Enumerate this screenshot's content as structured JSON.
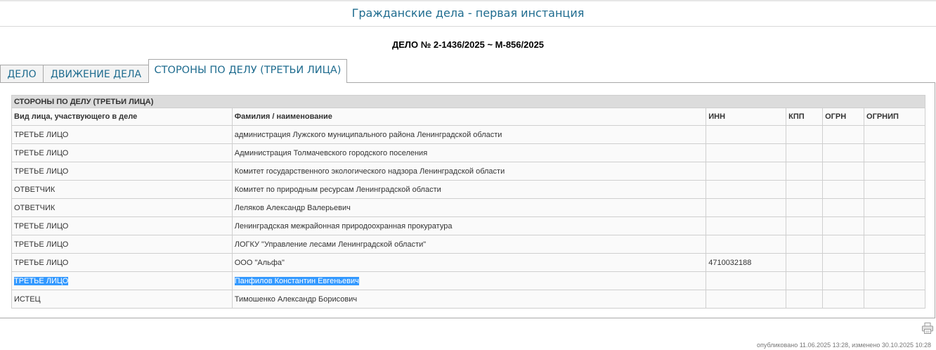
{
  "page_title": "Гражданские дела - первая инстанция",
  "case_title": "ДЕЛО № 2-1436/2025 ~ М-856/2025",
  "tabs": [
    {
      "label": "ДЕЛО"
    },
    {
      "label": "ДВИЖЕНИЕ ДЕЛА"
    },
    {
      "label": "СТОРОНЫ ПО ДЕЛУ (ТРЕТЬИ ЛИЦА)"
    }
  ],
  "active_tab": "СТОРОНЫ ПО ДЕЛУ (ТРЕТЬИ ЛИЦА)",
  "table": {
    "caption": "СТОРОНЫ ПО ДЕЛУ (ТРЕТЬИ ЛИЦА)",
    "headers": [
      "Вид лица, участвующего в деле",
      "Фамилия / наименование",
      "ИНН",
      "КПП",
      "ОГРН",
      "ОГРНИП"
    ],
    "rows": [
      [
        "ТРЕТЬЕ ЛИЦО",
        "администрация Лужского муниципального района Ленинградской области",
        "",
        "",
        "",
        ""
      ],
      [
        "ТРЕТЬЕ ЛИЦО",
        "Администрация Толмачевского городского поселения",
        "",
        "",
        "",
        ""
      ],
      [
        "ТРЕТЬЕ ЛИЦО",
        "Комитет государственного экологического надзора Ленинградской области",
        "",
        "",
        "",
        ""
      ],
      [
        "ОТВЕТЧИК",
        "Комитет по природным ресурсам Ленинградской области",
        "",
        "",
        "",
        ""
      ],
      [
        "ОТВЕТЧИК",
        "Леляков Александр Валерьевич",
        "",
        "",
        "",
        ""
      ],
      [
        "ТРЕТЬЕ ЛИЦО",
        "Ленинградская межрайонная природоохранная прокуратура",
        "",
        "",
        "",
        ""
      ],
      [
        "ТРЕТЬЕ ЛИЦО",
        "ЛОГКУ \"Управление лесами Ленинградской области\"",
        "",
        "",
        "",
        ""
      ],
      [
        "ТРЕТЬЕ ЛИЦО",
        "ООО \"Альфа\"",
        "4710032188",
        "",
        "",
        ""
      ],
      [
        "ТРЕТЬЕ ЛИЦО",
        "Панфилов Константин Евгеньевич",
        "",
        "",
        "",
        ""
      ],
      [
        "ИСТЕЦ",
        "Тимошенко Александр Борисович",
        "",
        "",
        "",
        ""
      ]
    ]
  },
  "footer": "опубликовано 11.06.2025 13:28, изменено 30.10.2025 10:28",
  "icons": {
    "print": "printer-icon"
  },
  "colors": {
    "title": "#1f6c8f",
    "selection": "#3399ff",
    "caption_bg": "#dcdcdc"
  }
}
